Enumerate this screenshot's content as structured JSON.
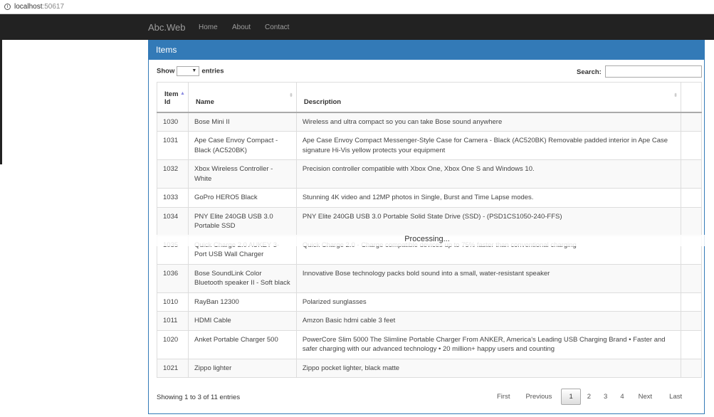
{
  "browser": {
    "url_host": "localhost",
    "url_port": ":50617"
  },
  "nav": {
    "brand": "Abc.Web",
    "links": [
      "Home",
      "About",
      "Contact"
    ]
  },
  "panel": {
    "title": "Items"
  },
  "controls": {
    "show_label": "Show",
    "entries_label": "entries",
    "page_length": "",
    "search_label": "Search:",
    "search_value": ""
  },
  "table": {
    "headers": [
      "Item Id",
      "Name",
      "Description",
      ""
    ],
    "sort": {
      "column": "Item Id",
      "direction": "asc"
    },
    "rows": [
      [
        "1030",
        "Bose Mini II",
        "Wireless and ultra compact so you can take Bose sound anywhere"
      ],
      [
        "1031",
        "Ape Case Envoy Compact - Black (AC520BK)",
        "Ape Case Envoy Compact Messenger-Style Case for Camera - Black (AC520BK) Removable padded interior in Ape Case signature Hi-Vis yellow protects your equipment"
      ],
      [
        "1032",
        "Xbox Wireless Controller - White",
        "Precision controller compatible with Xbox One, Xbox One S and Windows 10."
      ],
      [
        "1033",
        "GoPro HERO5 Black",
        "Stunning 4K video and 12MP photos in Single, Burst and Time Lapse modes."
      ],
      [
        "1034",
        "PNY Elite 240GB USB 3.0 Portable SSD",
        "PNY Elite 240GB USB 3.0 Portable Solid State Drive (SSD) - (PSD1CS1050-240-FFS)"
      ],
      [
        "1035",
        "Quick Charge 2.0 AUKEY 3-Port USB Wall Charger",
        "Quick Charge 2.0 - Charge compatible devices up to 75% faster than conventional charging"
      ],
      [
        "1036",
        "Bose SoundLink Color Bluetooth speaker II - Soft black",
        "Innovative Bose technology packs bold sound into a small, water-resistant speaker"
      ],
      [
        "1010",
        "RayBan 12300",
        "Polarized sunglasses"
      ],
      [
        "1011",
        "HDMI Cable",
        "Amzon Basic hdmi cable 3 feet"
      ],
      [
        "1020",
        "Anket Portable Charger 500",
        "PowerCore Slim 5000 The Slimline Portable Charger From ANKER, America's Leading USB Charging Brand • Faster and safer charging with our advanced technology • 20 million+ happy users and counting"
      ],
      [
        "1021",
        "Zippo lighter",
        "Zippo pocket lighter, black matte"
      ]
    ]
  },
  "processing": "Processing...",
  "footer": {
    "info": "Showing 1 to 3 of 11 entries",
    "pager": [
      "First",
      "Previous",
      "1",
      "2",
      "3",
      "4",
      "Next",
      "Last"
    ],
    "current_page": "1"
  }
}
